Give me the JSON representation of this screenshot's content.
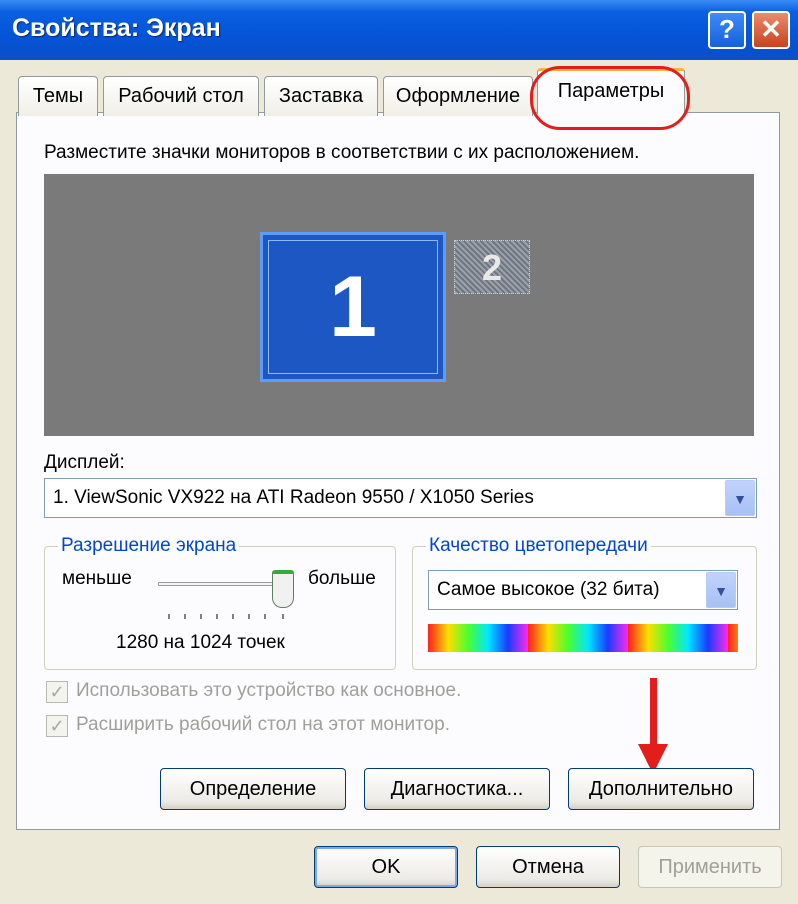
{
  "window": {
    "title": "Свойства: Экран",
    "help_glyph": "?",
    "close_glyph": "✕"
  },
  "tabs": [
    {
      "label": "Темы"
    },
    {
      "label": "Рабочий стол"
    },
    {
      "label": "Заставка"
    },
    {
      "label": "Оформление"
    },
    {
      "label": "Параметры",
      "active": true
    }
  ],
  "settings": {
    "instruction": "Разместите значки мониторов в соответствии с их расположением.",
    "monitors": [
      {
        "number": "1"
      },
      {
        "number": "2"
      }
    ],
    "display_label": "Дисплей:",
    "display_value": "1. ViewSonic VX922 на ATI Radeon 9550 / X1050 Series",
    "resolution": {
      "title": "Разрешение экрана",
      "less": "меньше",
      "more": "больше",
      "value_text": "1280 на 1024 точек",
      "slider_level": 0.92
    },
    "color_quality": {
      "title": "Качество цветопередачи",
      "value": "Самое высокое (32 бита)"
    },
    "checkboxes": [
      {
        "label": "Использовать это устройство как основное.",
        "checked": true,
        "enabled": false
      },
      {
        "label": "Расширить рабочий стол на этот монитор.",
        "checked": true,
        "enabled": false
      }
    ],
    "buttons": {
      "identify": "Определение",
      "troubleshoot": "Диагностика...",
      "advanced": "Дополнительно"
    }
  },
  "footer": {
    "ok": "OK",
    "cancel": "Отмена",
    "apply": "Применить"
  },
  "colors": {
    "title_bar": "#0554d8",
    "highlight": "#e31c1c",
    "group_title": "#0046d5",
    "monitor_bg": "#7a7a7a",
    "monitor_primary": "#1c57c4"
  },
  "icons": {
    "dropdown": "chevron-down-icon",
    "check": "check-icon"
  }
}
